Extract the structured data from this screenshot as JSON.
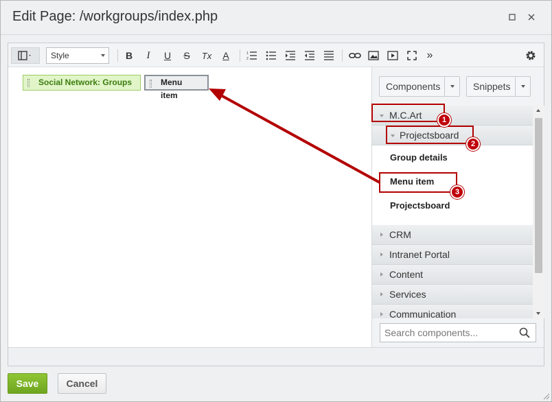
{
  "dialog": {
    "title": "Edit Page: /workgroups/index.php",
    "maximize_icon": "maximize-icon",
    "close_icon": "close-icon"
  },
  "toolbar": {
    "style_select_value": "Style",
    "bold": "B",
    "italic": "I",
    "underline": "U",
    "strike": "S",
    "clear_format": "Tx",
    "font_color": "A",
    "more": "»"
  },
  "content": {
    "chip_group": "Social Network: Groups",
    "chip_menu": "Menu item"
  },
  "panel": {
    "components_label": "Components",
    "snippets_label": "Snippets",
    "groups": {
      "mcart": "M.C.Art",
      "projectsboard": "Projectsboard",
      "crm": "CRM",
      "intranet": "Intranet Portal",
      "content": "Content",
      "services": "Services",
      "communication": "Communication"
    },
    "leaves": [
      "Group details",
      "Menu item",
      "Projectsboard"
    ],
    "search_placeholder": "Search components..."
  },
  "footer": {
    "save_label": "Save",
    "cancel_label": "Cancel"
  },
  "annotations": {
    "badges": [
      "1",
      "2",
      "3"
    ],
    "color": "#b30000"
  }
}
